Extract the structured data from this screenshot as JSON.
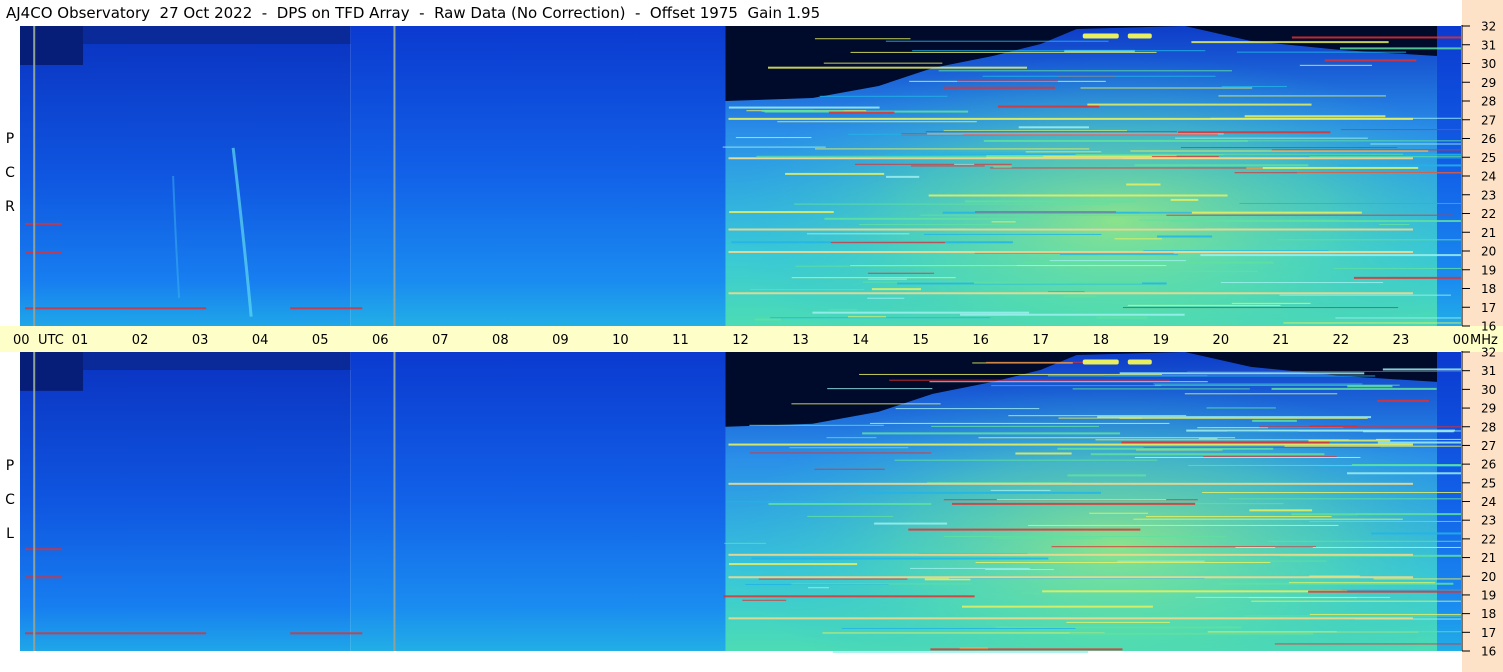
{
  "title": "AJ4CO Observatory  27 Oct 2022  -  DPS on TFD Array  -  Raw Data (No Correction)  -  Offset 1975  Gain 1.95",
  "panels": [
    {
      "label_letters": [
        "P",
        "C",
        "R"
      ]
    },
    {
      "label_letters": [
        "P",
        "C",
        "L"
      ]
    }
  ],
  "time_axis": {
    "utc_label": "UTC",
    "ticks": [
      "00",
      "01",
      "02",
      "03",
      "04",
      "05",
      "06",
      "07",
      "08",
      "09",
      "10",
      "11",
      "12",
      "13",
      "14",
      "15",
      "16",
      "17",
      "18",
      "19",
      "20",
      "21",
      "22",
      "23",
      "00"
    ]
  },
  "freq_axis": {
    "unit": "MHz",
    "ticks": [
      "32",
      "31",
      "30",
      "29",
      "28",
      "27",
      "26",
      "25",
      "24",
      "23",
      "22",
      "21",
      "20",
      "19",
      "18",
      "17",
      "16"
    ]
  },
  "colors": {
    "background_dark": "#000a2a",
    "deep_blue": "#0a3fd8",
    "blue": "#1565f0",
    "cyan": "#22b4e8",
    "green": "#5fe0a0",
    "yellow": "#e8f060",
    "red": "#e23030",
    "axis_band": "#fefec8",
    "right_band": "#fde2c8"
  },
  "chart_data": [
    {
      "type": "heatmap",
      "title": "RCP",
      "x_range_utc": [
        0,
        24
      ],
      "y_range_mhz": [
        16,
        32
      ]
    },
    {
      "type": "heatmap",
      "title": "LCP",
      "x_range_utc": [
        0,
        24
      ],
      "y_range_mhz": [
        16,
        32
      ]
    }
  ]
}
